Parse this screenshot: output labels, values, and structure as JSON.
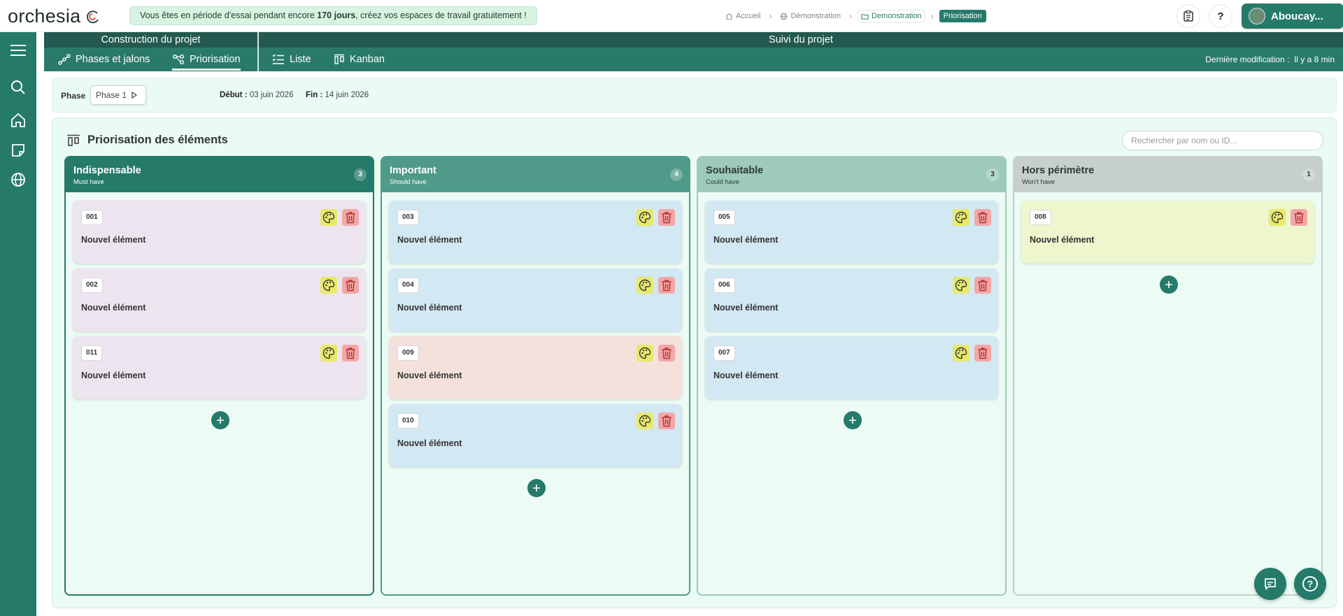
{
  "brand": {
    "name": "orchesia"
  },
  "trial_banner": {
    "prefix": "Vous êtes en période d'essai pendant encore ",
    "days": "170 jours",
    "suffix": ", créez vos espaces de travail gratuitement !"
  },
  "breadcrumb": [
    {
      "label": "Accueil",
      "icon": "home-icon"
    },
    {
      "label": "Démonstration",
      "icon": "globe-icon"
    },
    {
      "label": "Demonstration",
      "icon": "folder-icon"
    },
    {
      "label": "Priorisation"
    }
  ],
  "user": {
    "name": "Aboucay..."
  },
  "subnav": {
    "section_build": "Construction du projet",
    "section_track": "Suivi du projet",
    "tabs": [
      {
        "label": "Phases et jalons",
        "icon": "timeline-icon"
      },
      {
        "label": "Priorisation",
        "icon": "share-nodes-icon",
        "active": true
      },
      {
        "label": "Liste",
        "icon": "list-icon"
      },
      {
        "label": "Kanban",
        "icon": "kanban-icon"
      }
    ],
    "last_modified_label": "Dernière modification :",
    "last_modified_value": "Il y a 8 min"
  },
  "phase": {
    "label": "Phase",
    "selected": "Phase 1",
    "start_label": "Début :",
    "start_value": "03 juin 2026",
    "end_label": "Fin :",
    "end_value": "14 juin 2026"
  },
  "board": {
    "title": "Priorisation des éléments",
    "search_placeholder": "Rechercher par nom ou ID...",
    "columns": [
      {
        "title": "Indispensable",
        "subtitle": "Must have",
        "count": "3",
        "header_color": "#257a6a",
        "text_color": "#ffffff",
        "border_color": "#257a6a",
        "cards": [
          {
            "id": "001",
            "title": "Nouvel élément",
            "color": "#ece5ef"
          },
          {
            "id": "002",
            "title": "Nouvel élément",
            "color": "#ece5ef"
          },
          {
            "id": "011",
            "title": "Nouvel élément",
            "color": "#ece5ef"
          }
        ]
      },
      {
        "title": "Important",
        "subtitle": "Should have",
        "count": "4",
        "header_color": "#4f9a89",
        "text_color": "#ffffff",
        "border_color": "#4f9a89",
        "cards": [
          {
            "id": "003",
            "title": "Nouvel élément",
            "color": "#d2e8f3"
          },
          {
            "id": "004",
            "title": "Nouvel élément",
            "color": "#d2e8f3"
          },
          {
            "id": "009",
            "title": "Nouvel élément",
            "color": "#f5e1dc"
          },
          {
            "id": "010",
            "title": "Nouvel élément",
            "color": "#d2e8f3"
          }
        ]
      },
      {
        "title": "Souhaitable",
        "subtitle": "Could have",
        "count": "3",
        "header_color": "#9ecab9",
        "text_color": "#2b3b36",
        "border_color": "#9ecab9",
        "cards": [
          {
            "id": "005",
            "title": "Nouvel élément",
            "color": "#d2e8f3"
          },
          {
            "id": "006",
            "title": "Nouvel élément",
            "color": "#d2e8f3"
          },
          {
            "id": "007",
            "title": "Nouvel élément",
            "color": "#d2e8f3"
          }
        ]
      },
      {
        "title": "Hors périmètre",
        "subtitle": "Won't have",
        "count": "1",
        "header_color": "#c6cfca",
        "text_color": "#2b3b36",
        "border_color": "#c6cfca",
        "cards": [
          {
            "id": "008",
            "title": "Nouvel élément",
            "color": "#edf6cd"
          }
        ]
      }
    ]
  },
  "colors": {
    "primary": "#257a6a",
    "palette_button": "#e7e96b",
    "delete_button": "#f2a7a7"
  }
}
